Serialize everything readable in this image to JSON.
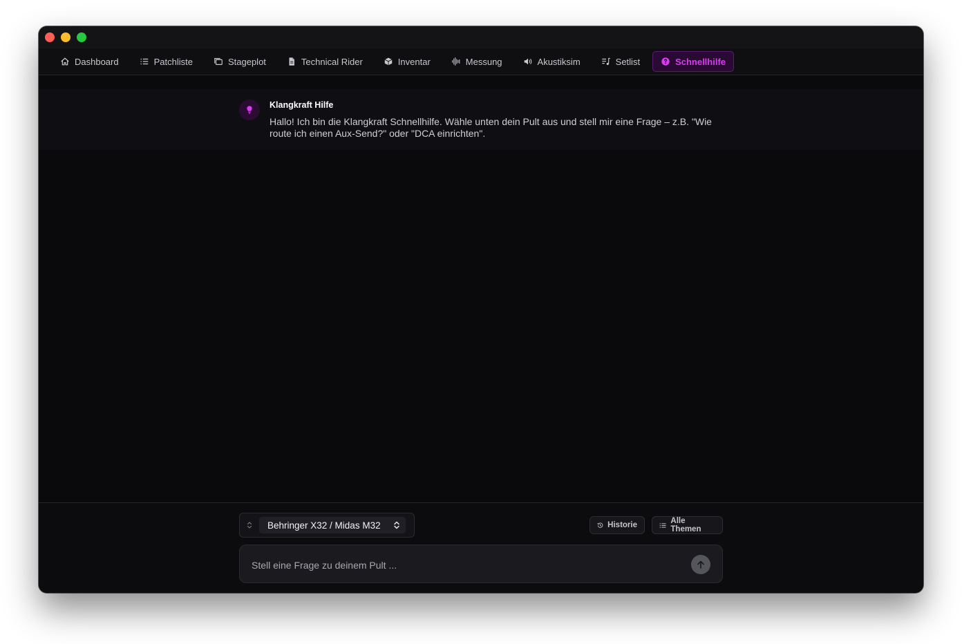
{
  "nav": {
    "tabs": [
      {
        "label": "Dashboard",
        "icon": "home-icon"
      },
      {
        "label": "Patchliste",
        "icon": "list-icon"
      },
      {
        "label": "Stageplot",
        "icon": "stage-icon"
      },
      {
        "label": "Technical Rider",
        "icon": "document-icon"
      },
      {
        "label": "Inventar",
        "icon": "box-icon"
      },
      {
        "label": "Messung",
        "icon": "waveform-icon"
      },
      {
        "label": "Akustiksim",
        "icon": "speaker-icon"
      },
      {
        "label": "Setlist",
        "icon": "music-list-icon"
      },
      {
        "label": "Schnellhilfe",
        "icon": "help-circle-icon",
        "active": true
      }
    ]
  },
  "chat": {
    "messages": [
      {
        "sender": "Klangkraft Hilfe",
        "text": "Hallo! Ich bin die Klangkraft Schnellhilfe. Wähle unten dein Pult aus und stell mir eine Frage – z.B. \"Wie route ich einen Aux-Send?\" oder \"DCA einrichten\".",
        "avatar_icon": "lightbulb-icon"
      }
    ]
  },
  "footer": {
    "console_select": {
      "value": "Behringer X32 / Midas M32"
    },
    "historie_label": "Historie",
    "alle_themen_label": "Alle Themen",
    "input": {
      "value": "",
      "placeholder": "Stell eine Frage zu deinem Pult ..."
    }
  },
  "colors": {
    "accent": "#d93cf0",
    "window_bg": "#0a0a0c",
    "traffic_red": "#ff5f57",
    "traffic_yellow": "#febc2e",
    "traffic_green": "#28c840"
  }
}
